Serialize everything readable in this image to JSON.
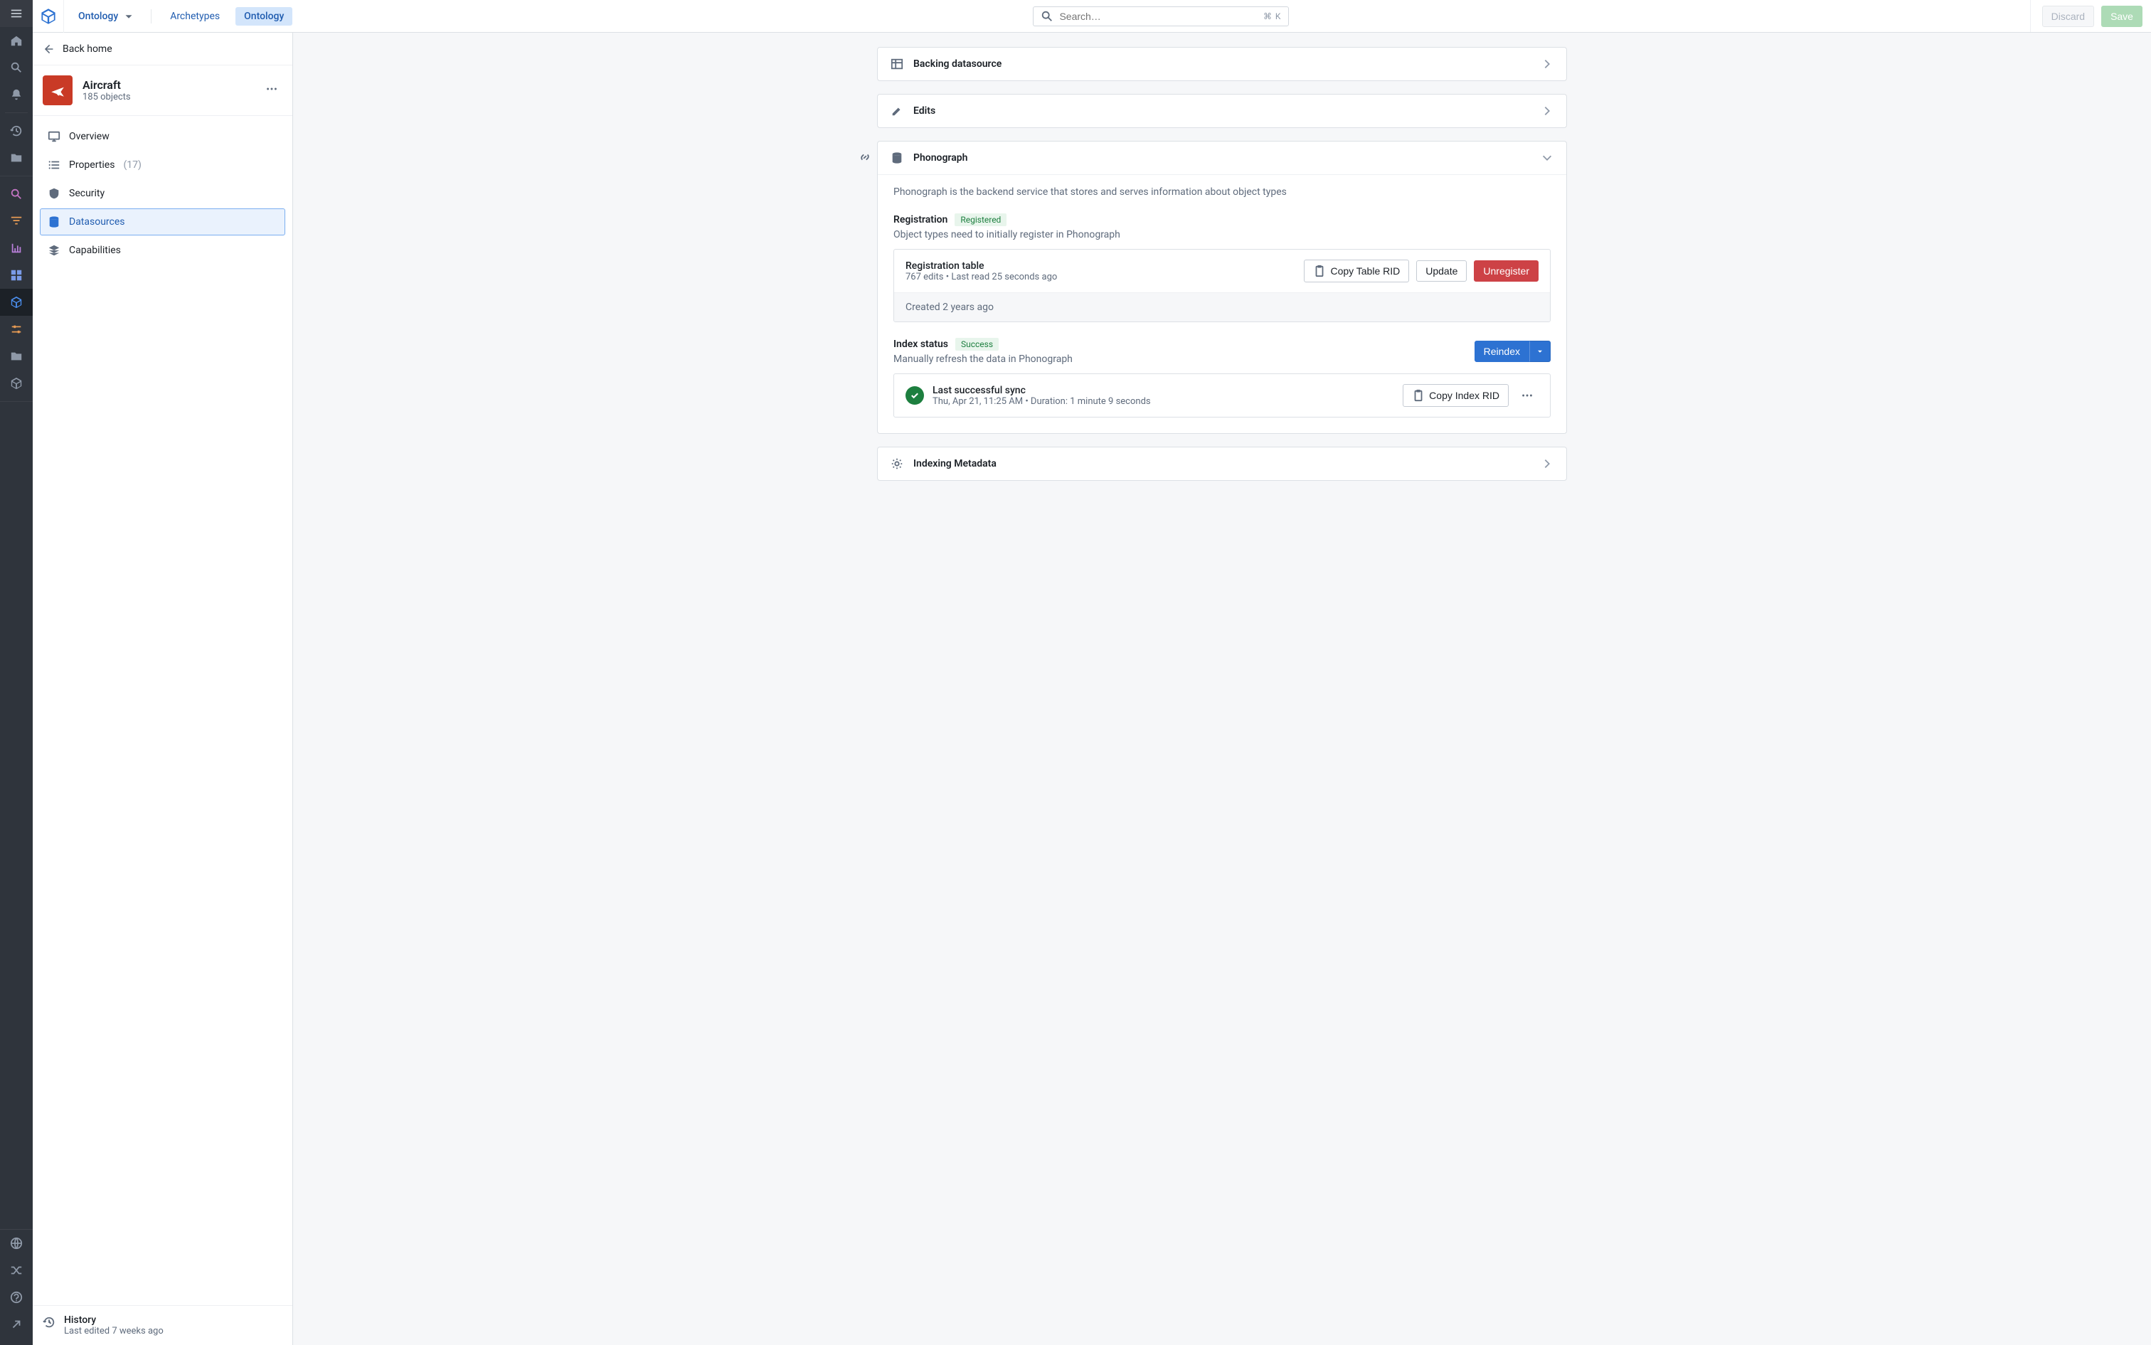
{
  "header": {
    "crumb_label": "Ontology",
    "tab_archetypes": "Archetypes",
    "tab_ontology": "Ontology",
    "search_placeholder": "Search…",
    "search_shortcut": "⌘ K",
    "discard": "Discard",
    "save": "Save"
  },
  "sidepanel": {
    "back": "Back home",
    "object": {
      "title": "Aircraft",
      "subtitle": "185 objects"
    },
    "nav": {
      "overview": "Overview",
      "properties": "Properties",
      "properties_count": "(17)",
      "security": "Security",
      "datasources": "Datasources",
      "capabilities": "Capabilities"
    },
    "footer": {
      "title": "History",
      "sub": "Last edited 7 weeks ago"
    }
  },
  "cards": {
    "backing": "Backing datasource",
    "edits": "Edits",
    "indexing_meta": "Indexing Metadata"
  },
  "phono": {
    "title": "Phonograph",
    "desc": "Phonograph is the backend service that stores and serves information about object types",
    "registration": {
      "title": "Registration",
      "badge": "Registered",
      "sub": "Object types need to initially register in Phonograph",
      "panel_title": "Registration table",
      "panel_sub": "767 edits • Last read 25 seconds ago",
      "foot": "Created 2 years ago",
      "copy": "Copy Table RID",
      "update": "Update",
      "unregister": "Unregister"
    },
    "index": {
      "title": "Index status",
      "badge": "Success",
      "sub": "Manually refresh the data in Phonograph",
      "reindex": "Reindex",
      "panel_title": "Last successful sync",
      "panel_sub": "Thu, Apr 21, 11:25 AM • Duration: 1 minute 9 seconds",
      "copy": "Copy Index RID"
    }
  }
}
